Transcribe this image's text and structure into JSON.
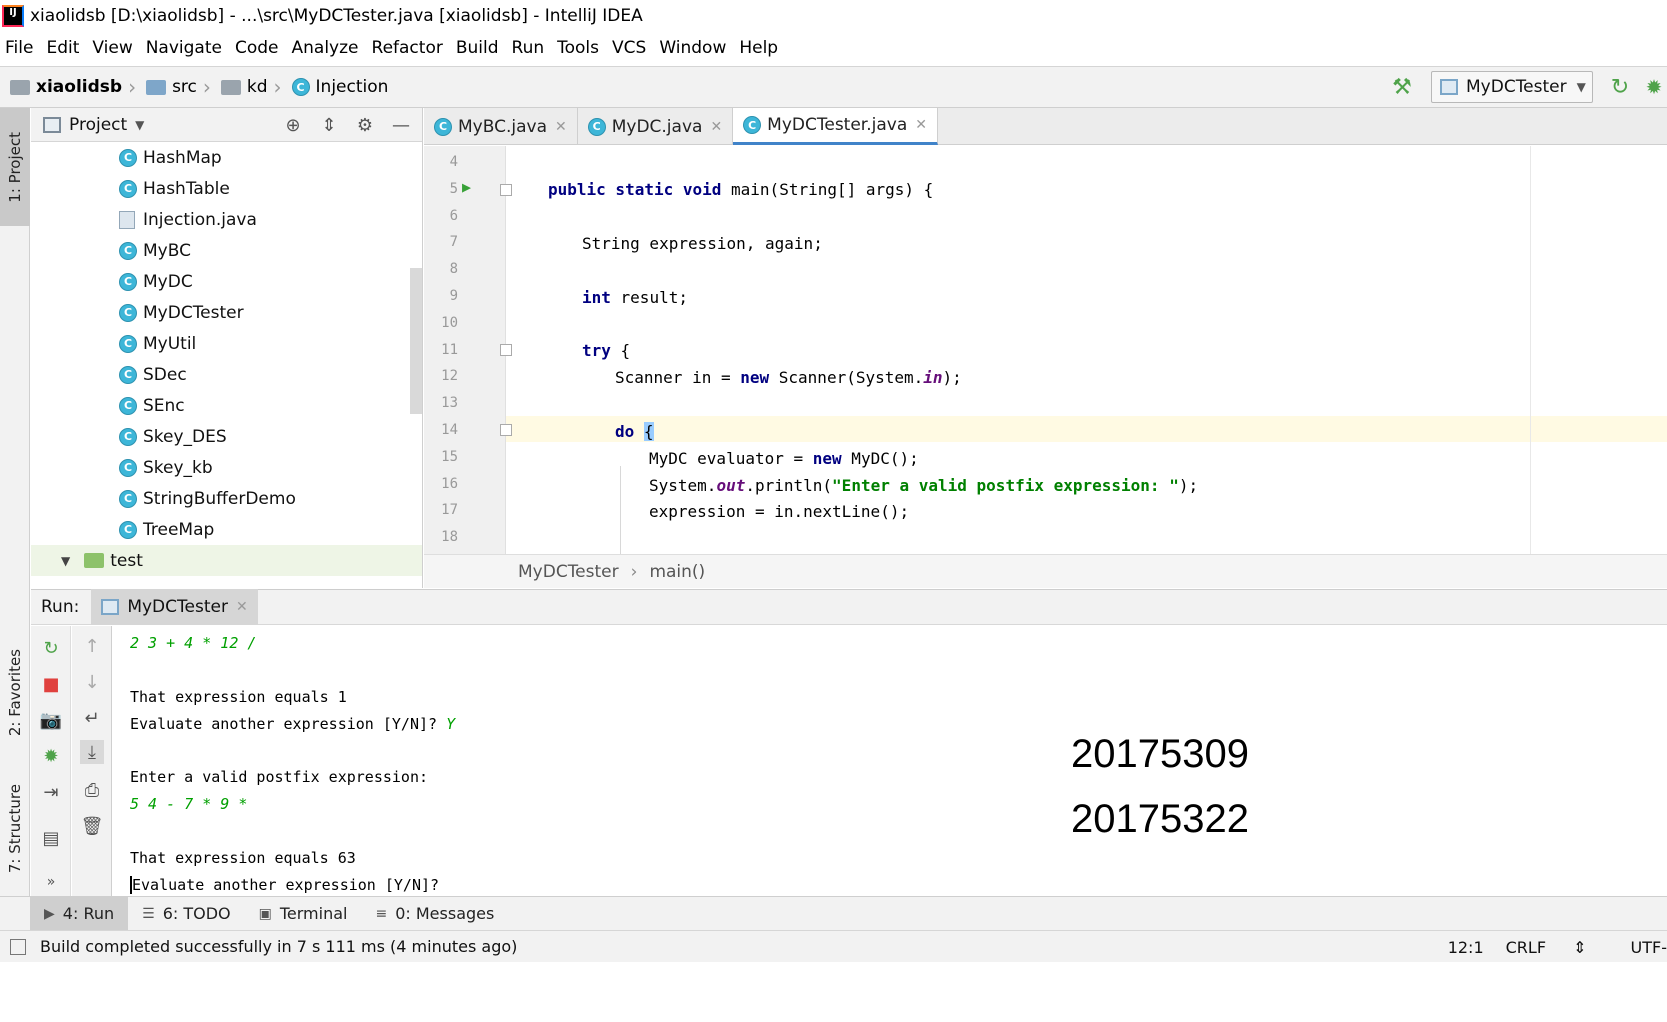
{
  "window": {
    "title": "xiaolidsb [D:\\xiaolidsb] - ...\\src\\MyDCTester.java [xiaolidsb] - IntelliJ IDEA",
    "logo_text": "IJ"
  },
  "menu": [
    "File",
    "Edit",
    "View",
    "Navigate",
    "Code",
    "Analyze",
    "Refactor",
    "Build",
    "Run",
    "Tools",
    "VCS",
    "Window",
    "Help"
  ],
  "breadcrumbs": [
    "xiaolidsb",
    "src",
    "kd",
    "Injection"
  ],
  "run_config": "MyDCTester",
  "left_tabs": {
    "project": "1: Project",
    "favorites": "2: Favorites",
    "structure": "7: Structure"
  },
  "project_panel": {
    "title": "Project",
    "items": [
      "HashMap",
      "HashTable",
      "Injection.java",
      "MyBC",
      "MyDC",
      "MyDCTester",
      "MyUtil",
      "SDec",
      "SEnc",
      "Skey_DES",
      "Skey_kb",
      "StringBufferDemo",
      "TreeMap"
    ],
    "folder": "test"
  },
  "editor": {
    "tabs": [
      "MyBC.java",
      "MyDC.java",
      "MyDCTester.java"
    ],
    "active_tab": "MyDCTester.java",
    "line_numbers": [
      "4",
      "5",
      "6",
      "7",
      "8",
      "9",
      "10",
      "11",
      "12",
      "13",
      "14",
      "15",
      "16",
      "17",
      "18"
    ],
    "code": {
      "l5_kw": "public static void",
      "l5_rest": " main(String[] args) {",
      "l7": "String expression, again;",
      "l9_kw": "int",
      "l9_rest": " result;",
      "l11_kw": "try",
      "l11_rest": " {",
      "l12_a": "Scanner in = ",
      "l12_kw": "new",
      "l12_b": " Scanner(System.",
      "l12_fld": "in",
      "l12_c": ");",
      "l14_kw": "do",
      "l14_brace": "{",
      "l15_a": "MyDC evaluator = ",
      "l15_kw": "new",
      "l15_b": " MyDC();",
      "l16_a": "System.",
      "l16_fld": "out",
      "l16_b": ".println(",
      "l16_str": "\"Enter a valid postfix expression: \"",
      "l16_c": ");",
      "l17": "expression = in.nextLine();"
    },
    "breadcrumb": [
      "MyDCTester",
      "main()"
    ]
  },
  "run_panel": {
    "label": "Run:",
    "tab": "MyDCTester",
    "console": {
      "l1": "2 3 + 4 * 12 /",
      "l2": "That expression equals 1",
      "l3a": "Evaluate another expression [Y/N]? ",
      "l3b": "Y",
      "l4": "Enter a valid postfix expression:",
      "l5": "5 4 - 7 * 9 *",
      "l6": "That expression equals 63",
      "l7": "Evaluate another expression [Y/N]?"
    },
    "overlay_numbers": [
      "20175309",
      "20175322"
    ]
  },
  "bottom_tabs": [
    "4: Run",
    "6: TODO",
    "Terminal",
    "0: Messages"
  ],
  "status": {
    "message": "Build completed successfully in 7 s 111 ms (4 minutes ago)",
    "position": "12:1",
    "line_sep": "CRLF",
    "encoding": "UTF-"
  },
  "colors": {
    "keyword": "#000080",
    "string": "#008000",
    "field": "#660e7a",
    "console_input": "#00a000",
    "accent": "#4083c9",
    "run_green": "#4fa34a"
  }
}
